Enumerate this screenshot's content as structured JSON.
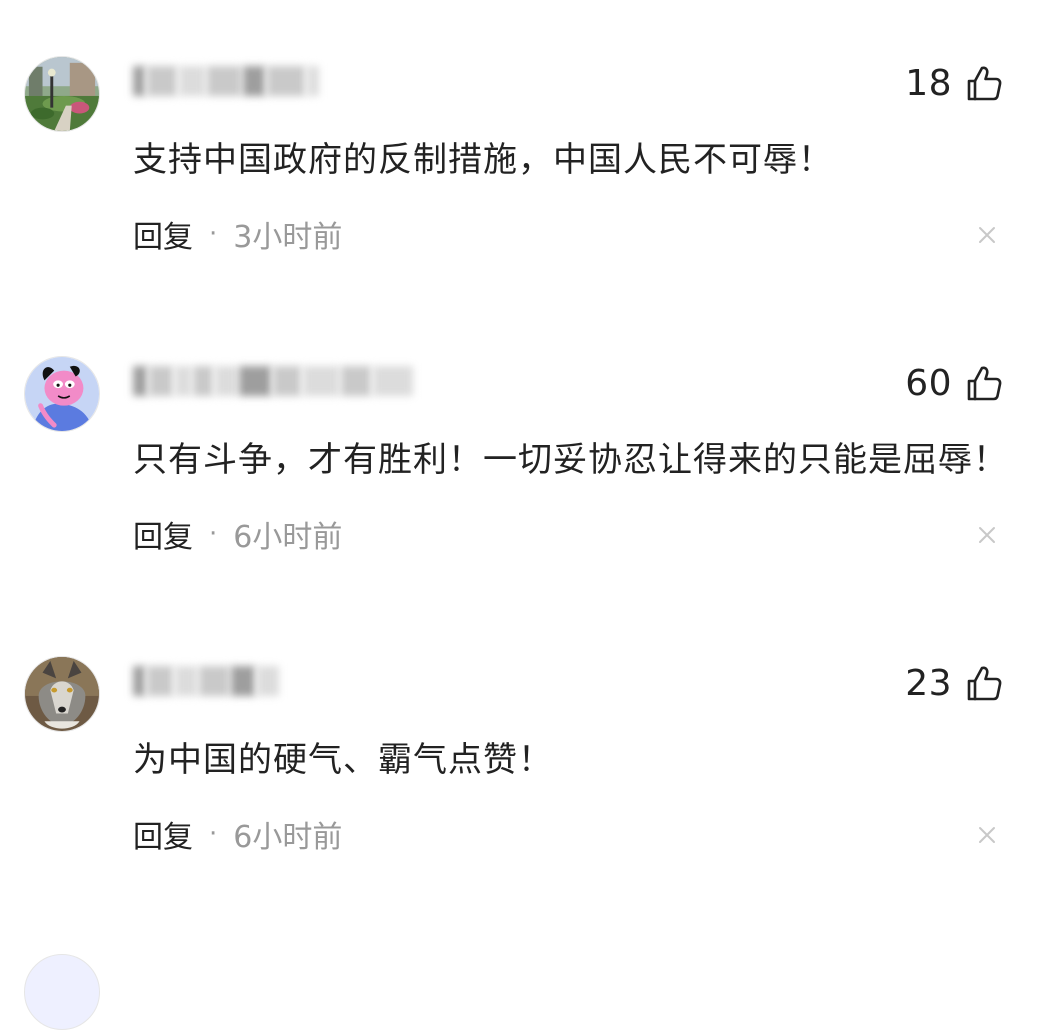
{
  "comments": [
    {
      "avatar_icon": "avatar-garden-photo",
      "like_count": "18",
      "text": "支持中国政府的反制措施，中国人民不可辱！",
      "reply_label": "回复",
      "separator": "·",
      "time": "3小时前"
    },
    {
      "avatar_icon": "avatar-cartoon-character",
      "like_count": "60",
      "text": "只有斗争，才有胜利！一切妥协忍让得来的只能是屈辱！",
      "reply_label": "回复",
      "separator": "·",
      "time": "6小时前"
    },
    {
      "avatar_icon": "avatar-wolf-photo",
      "like_count": "23",
      "text": "为中国的硬气、霸气点赞！",
      "reply_label": "回复",
      "separator": "·",
      "time": "6小时前"
    }
  ],
  "icons": {
    "like": "thumbs-up-icon",
    "close": "close-icon"
  },
  "colors": {
    "text_primary": "#222222",
    "text_secondary": "#999999",
    "close_icon": "#c8c8c8"
  }
}
